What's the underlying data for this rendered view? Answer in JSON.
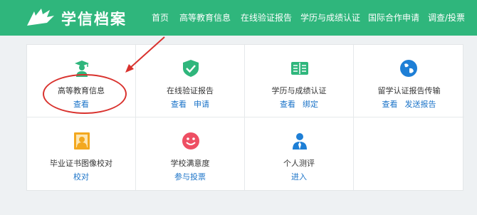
{
  "header": {
    "brand": "学信档案",
    "nav": [
      "首页",
      "高等教育信息",
      "在线验证报告",
      "学历与成绩认证",
      "国际合作申请",
      "调查/投票"
    ]
  },
  "cells": [
    {
      "label": "高等教育信息",
      "links": [
        "查看"
      ],
      "icon": "graduate-icon"
    },
    {
      "label": "在线验证报告",
      "links": [
        "查看",
        "申请"
      ],
      "icon": "shield-check-icon"
    },
    {
      "label": "学历与成绩认证",
      "links": [
        "查看",
        "绑定"
      ],
      "icon": "book-icon"
    },
    {
      "label": "留学认证报告传输",
      "links": [
        "查看",
        "发送报告"
      ],
      "icon": "globe-icon"
    },
    {
      "label": "毕业证书图像校对",
      "links": [
        "校对"
      ],
      "icon": "portrait-icon"
    },
    {
      "label": "学校满意度",
      "links": [
        "参与投票"
      ],
      "icon": "smiley-icon"
    },
    {
      "label": "个人测评",
      "links": [
        "进入"
      ],
      "icon": "person-tie-icon"
    }
  ],
  "colors": {
    "header": "#2fb67c",
    "link": "#1a73c8",
    "annotation": "#d9322e"
  }
}
